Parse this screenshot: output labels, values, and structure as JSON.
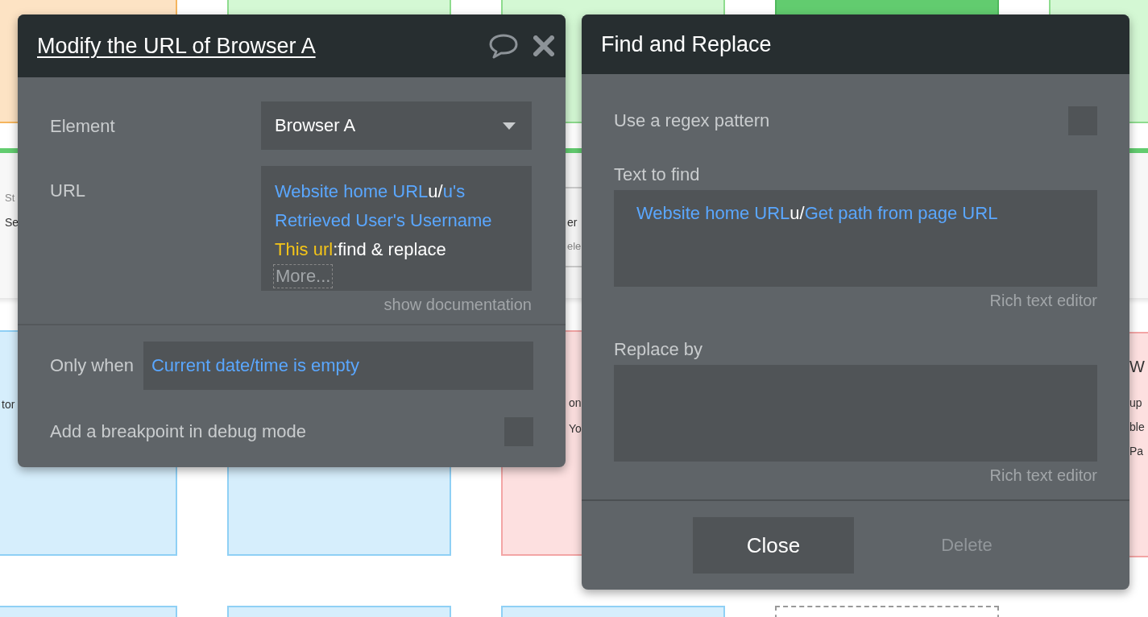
{
  "canvas": {
    "cards": [
      {
        "kind": "warning"
      },
      {
        "kind": "success"
      },
      {
        "kind": "success"
      },
      {
        "kind": "success_strong"
      },
      {
        "kind": "success"
      },
      {
        "kind": "panel",
        "texts": [
          {
            "text": "St",
            "kind": "caption"
          },
          {
            "text": "Se",
            "kind": "value"
          },
          {
            "text": "er",
            "kind": "value"
          },
          {
            "text": "ele",
            "kind": "caption"
          }
        ]
      },
      {
        "kind": "info",
        "texts": [
          {
            "text": "tor",
            "kind": "value"
          }
        ]
      },
      {
        "kind": "info"
      },
      {
        "kind": "error",
        "texts": [
          {
            "text": "on",
            "kind": "value"
          },
          {
            "text": "Yo",
            "kind": "value"
          }
        ]
      },
      {
        "kind": "error",
        "texts": [
          {
            "text": "W",
            "kind": "heading"
          },
          {
            "text": "up",
            "kind": "value"
          },
          {
            "text": "ble",
            "kind": "value"
          },
          {
            "text": "Pa",
            "kind": "value"
          }
        ]
      },
      {
        "kind": "info"
      },
      {
        "kind": "info"
      },
      {
        "kind": "info"
      },
      {
        "kind": "empty"
      }
    ]
  },
  "action_dialog": {
    "title": "Modify the URL of Browser A",
    "element": {
      "label": "Element",
      "value": "Browser A"
    },
    "url": {
      "label": "URL",
      "segments": [
        {
          "text": " Website home URL",
          "kind": "dynamic"
        },
        {
          "text": "u/",
          "kind": "literal"
        },
        {
          "text": "u's Retrieved User's Username ",
          "kind": "dynamic"
        },
        {
          "text": "This url",
          "kind": "source"
        },
        {
          "text": ":find & replace",
          "kind": "literal"
        }
      ],
      "more": "More..."
    },
    "documentation_link": "show documentation",
    "only_when": {
      "label": "Only when",
      "value": "Current date/time is empty"
    },
    "breakpoint": {
      "label": "Add a breakpoint in debug mode",
      "checked": false
    }
  },
  "find_replace_dialog": {
    "title": "Find and Replace",
    "regex": {
      "label": "Use a regex pattern",
      "checked": false
    },
    "text_to_find": {
      "label": "Text to find",
      "segments": [
        {
          "text": "Website home URL",
          "kind": "dynamic"
        },
        {
          "text": "u/",
          "kind": "literal"
        },
        {
          "text": "Get path from page URL",
          "kind": "dynamic"
        }
      ],
      "editor_link": "Rich text editor"
    },
    "replace_by": {
      "label": "Replace by",
      "editor_link": "Rich text editor"
    },
    "buttons": [
      {
        "label": "Close",
        "disabled": false
      },
      {
        "label": "Delete",
        "disabled": true
      }
    ]
  }
}
